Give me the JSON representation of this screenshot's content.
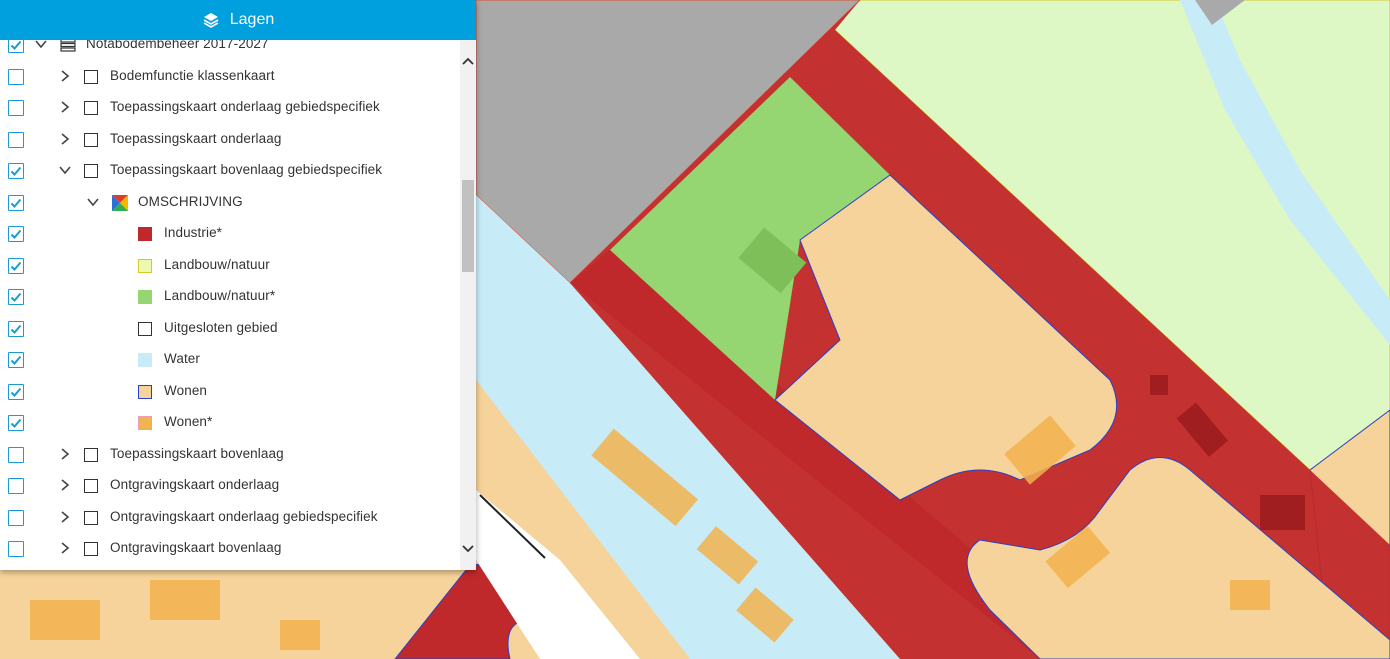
{
  "panel": {
    "title": "Lagen",
    "icon": "layers-icon",
    "accent": "#009fde"
  },
  "layers": [
    {
      "label": "Notabodembeheer 2017-2027",
      "checked": true,
      "expand": "open",
      "indent": 0,
      "icon": "layer-group-icon"
    },
    {
      "label": "Bodemfunctie klassenkaart",
      "checked": false,
      "expand": "closed",
      "indent": 1
    },
    {
      "label": "Toepassingskaart onderlaag gebiedspecifiek",
      "checked": false,
      "expand": "closed",
      "indent": 1
    },
    {
      "label": "Toepassingskaart onderlaag",
      "checked": false,
      "expand": "closed",
      "indent": 1
    },
    {
      "label": "Toepassingskaart bovenlaag gebiedspecifiek",
      "checked": true,
      "expand": "open",
      "indent": 1
    },
    {
      "label": "OMSCHRIJVING",
      "checked": true,
      "expand": "open",
      "indent": 2,
      "icon": "legend-colors-icon"
    },
    {
      "label": "Industrie*",
      "checked": true,
      "swatch": "#c0292b",
      "swatchBorder": "#c0292b"
    },
    {
      "label": "Landbouw/natuur",
      "checked": true,
      "swatch": "#eef9b0",
      "swatchBorder": "#d8c82a"
    },
    {
      "label": "Landbouw/natuur*",
      "checked": true,
      "swatch": "#95d672",
      "swatchBorder": "#95d672"
    },
    {
      "label": "Uitgesloten gebied",
      "checked": true,
      "swatch": "#ffffff",
      "swatchBorder": "#333333"
    },
    {
      "label": "Water",
      "checked": true,
      "swatch": "#c7ecf8",
      "swatchBorder": "#c7ecf8"
    },
    {
      "label": "Wonen",
      "checked": true,
      "swatch": "#f6d39a",
      "swatchBorder": "#2b3fc8"
    },
    {
      "label": "Wonen*",
      "checked": true,
      "swatch": "#f3b34f",
      "swatchBorder": "#e8a0b0"
    },
    {
      "label": "Toepassingskaart bovenlaag",
      "checked": false,
      "expand": "closed",
      "indent": 1
    },
    {
      "label": "Ontgravingskaart onderlaag",
      "checked": false,
      "expand": "closed",
      "indent": 1
    },
    {
      "label": "Ontgravingskaart onderlaag gebiedspecifiek",
      "checked": false,
      "expand": "closed",
      "indent": 1
    },
    {
      "label": "Ontgravingskaart bovenlaag",
      "checked": false,
      "expand": "closed",
      "indent": 1
    }
  ],
  "map_colors": {
    "industrie": "#c0292b",
    "landbouw": "#ddf8c4",
    "landbouw_star": "#95d672",
    "water": "#c7ecf8",
    "wonen": "#f6d39a",
    "wonen_star": "#f3b34f",
    "grey": "#a9a9a9"
  }
}
